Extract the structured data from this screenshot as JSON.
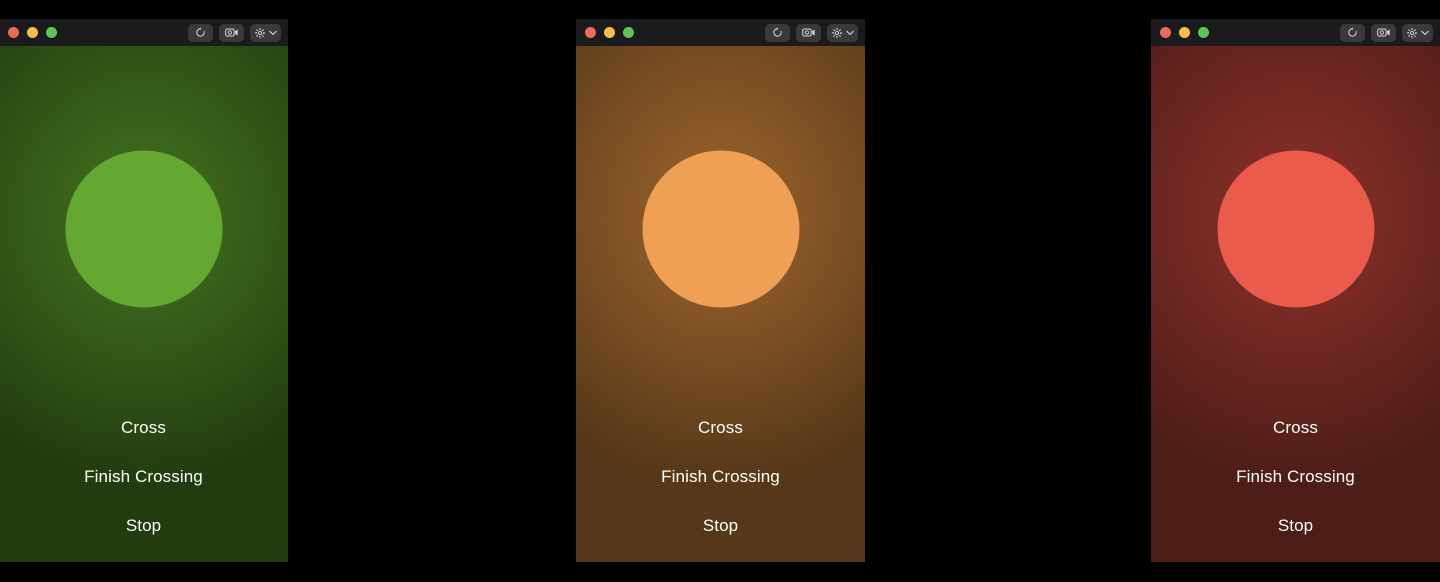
{
  "app": {
    "background_color": "#000000",
    "window_count": 3
  },
  "titlebar": {
    "background_color": "#1b1b1d",
    "traffic_lights": [
      {
        "name": "close",
        "color": "#ee6a5f"
      },
      {
        "name": "minimize",
        "color": "#f5bd4f"
      },
      {
        "name": "zoom",
        "color": "#61c555"
      }
    ],
    "buttons": [
      {
        "name": "rotate-button",
        "icon": "rotate-icon",
        "label": ""
      },
      {
        "name": "record-button",
        "icon": "video-icon",
        "label": ""
      },
      {
        "name": "settings-button",
        "icon": "gear-icon",
        "label": "",
        "has_chevron": true
      }
    ]
  },
  "windows": [
    {
      "id": "win-green",
      "state": "go",
      "lamp_color": "#64a832",
      "bg_inner": "#2f5216",
      "bg_outer": "#223c10",
      "glow_color": "rgba(118,190,55,0.30)",
      "labels": [
        "Cross",
        "Finish Crossing",
        "Stop"
      ]
    },
    {
      "id": "win-orange",
      "state": "caution",
      "lamp_color": "#f0a055",
      "bg_inner": "#7a4f22",
      "bg_outer": "#553719",
      "glow_color": "rgba(236,150,70,0.30)",
      "labels": [
        "Cross",
        "Finish Crossing",
        "Stop"
      ]
    },
    {
      "id": "win-red",
      "state": "stop",
      "lamp_color": "#eb5b4b",
      "bg_inner": "#6b2620",
      "bg_outer": "#4d1d18",
      "glow_color": "rgba(225,80,65,0.28)",
      "labels": [
        "Cross",
        "Finish Crossing",
        "Stop"
      ]
    }
  ]
}
